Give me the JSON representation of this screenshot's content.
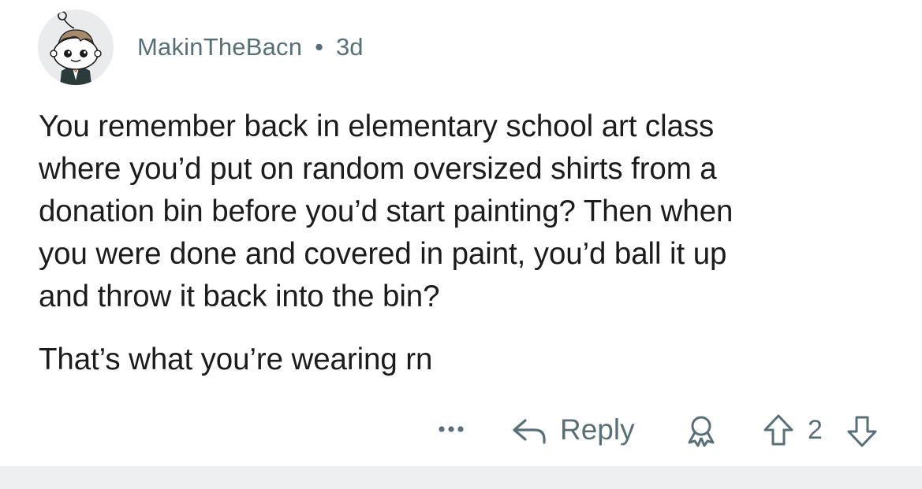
{
  "comment": {
    "author": "MakinTheBacn",
    "separator": "•",
    "age": "3d",
    "paragraphs": [
      "You remember back in elementary school art class\nwhere you’d put on random oversized shirts from a\ndonation bin before you’d start painting? Then when\nyou were done and covered in paint, you’d ball it up\nand throw it back into the bin?",
      "That’s what you’re wearing rn"
    ]
  },
  "actions": {
    "more_icon": "ellipsis-icon",
    "reply_icon": "reply-arrow-icon",
    "reply_label": "Reply",
    "award_icon": "award-icon",
    "upvote_icon": "upvote-arrow-icon",
    "score": "2",
    "downvote_icon": "downvote-arrow-icon"
  },
  "colors": {
    "meta_text": "#576f76",
    "body_text": "#1c1c1c",
    "avatar_bg": "#e9ebed",
    "footer_band": "#edeff1"
  }
}
